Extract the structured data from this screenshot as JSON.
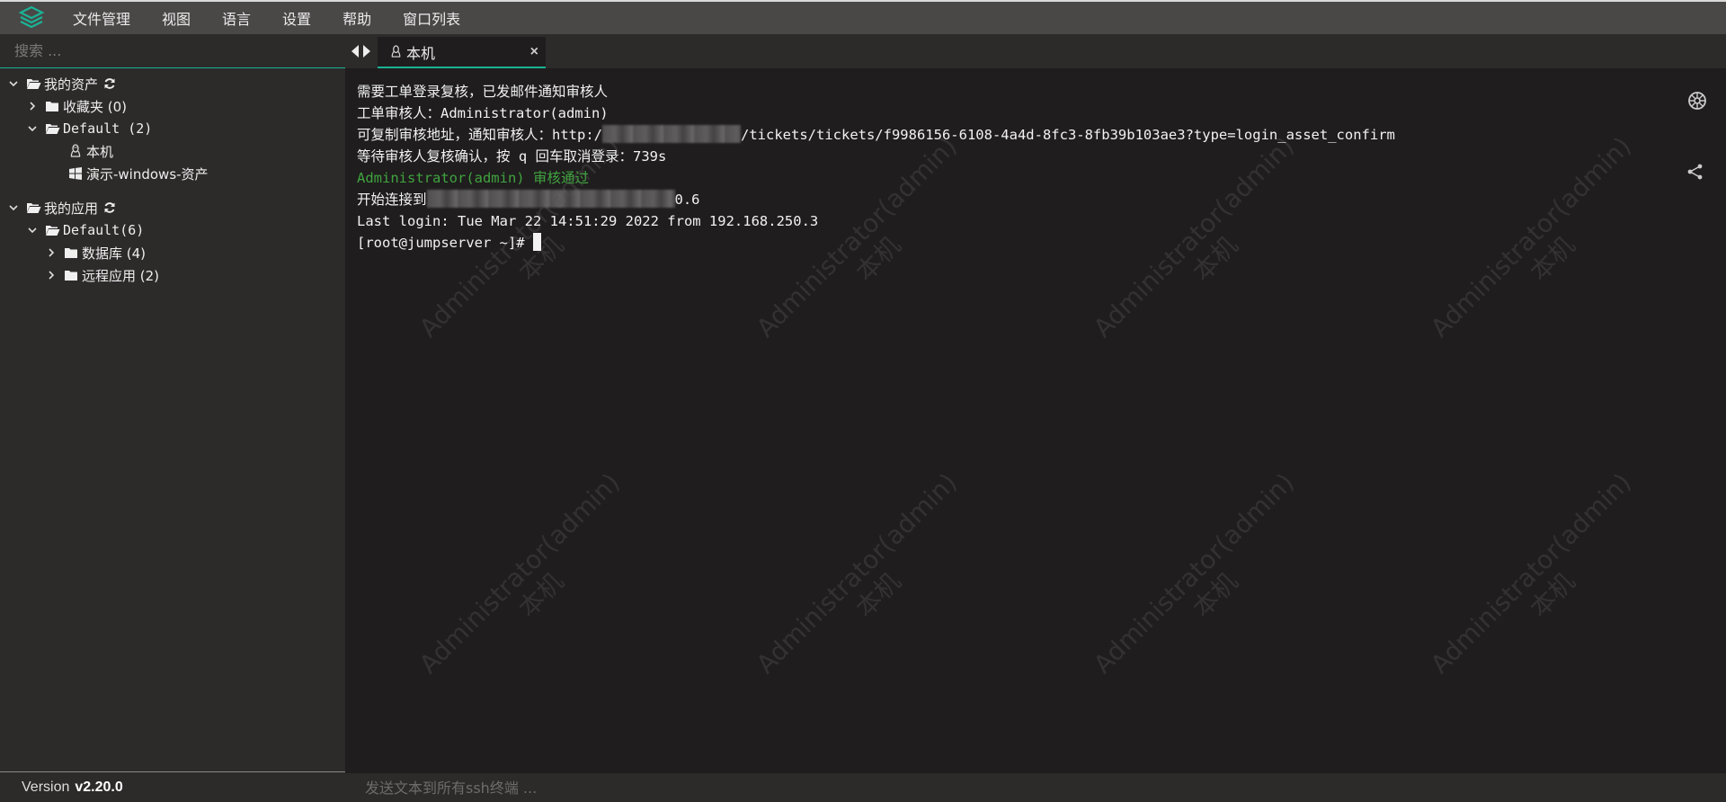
{
  "menu": {
    "items": [
      "文件管理",
      "视图",
      "语言",
      "设置",
      "帮助",
      "窗口列表"
    ]
  },
  "sidebar": {
    "search_placeholder": "搜索 ...",
    "tree": {
      "assets_root": "我的资产",
      "favorites": "收藏夹 (0)",
      "default_group": "Default (2)",
      "asset_local": "本机",
      "asset_windows": "演示-windows-资产",
      "apps_root": "我的应用",
      "apps_default": "Default(6)",
      "databases": "数据库 (4)",
      "remote_apps": "远程应用 (2)"
    },
    "version_label": "Version",
    "version_value": "v2.20.0"
  },
  "tabs": {
    "active_tab_label": "本机",
    "close_glyph": "×"
  },
  "terminal": {
    "line1": "需要工单登录复核，已发邮件通知审核人",
    "line2": "工单审核人：Administrator(admin)",
    "line3_prefix": "可复制审核地址，通知审核人：http:/",
    "line3_suffix": "/tickets/tickets/f9986156-6108-4a4d-8fc3-8fb39b103ae3?type=login_asset_confirm",
    "line4": "等待审核人复核确认，按 q 回车取消登录：739s",
    "line5": "Administrator(admin) 审核通过",
    "line6_prefix": "开始连接到",
    "line6_suffix": "0.6",
    "line7": "Last login: Tue Mar 22 14:51:29 2022 from 192.168.250.3",
    "line8": "[root@jumpserver ~]# ",
    "watermark_user": "Administrator(admin)",
    "watermark_asset": "本机"
  },
  "sendbar": {
    "placeholder": "发送文本到所有ssh终端 ..."
  },
  "colors": {
    "accent": "#1ab394",
    "menubar_bg": "#4a4747",
    "sidebar_bg": "#2d2a2a",
    "terminal_bg": "#1f1d1d",
    "approved_green": "#40a340"
  }
}
